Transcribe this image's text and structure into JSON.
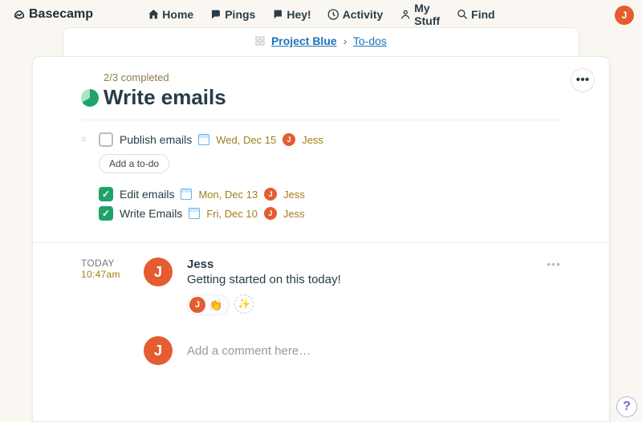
{
  "brand": "Basecamp",
  "nav": {
    "home": "Home",
    "pings": "Pings",
    "hey": "Hey!",
    "activity": "Activity",
    "mystuff": "My Stuff",
    "find": "Find"
  },
  "user_initial": "J",
  "breadcrumb": {
    "project": "Project Blue",
    "separator": "›",
    "section": "To-dos"
  },
  "list": {
    "completed_text": "2/3 completed",
    "title": "Write emails",
    "add_todo_label": "Add a to-do",
    "pending": [
      {
        "title": "Publish emails",
        "date": "Wed, Dec 15",
        "assignee_initial": "J",
        "assignee_name": "Jess"
      }
    ],
    "completed": [
      {
        "title": "Edit emails",
        "date": "Mon, Dec 13",
        "assignee_initial": "J",
        "assignee_name": "Jess"
      },
      {
        "title": "Write Emails",
        "date": "Fri, Dec 10",
        "assignee_initial": "J",
        "assignee_name": "Jess"
      }
    ]
  },
  "comments": [
    {
      "day_label": "TODAY",
      "time": "10:47am",
      "author_initial": "J",
      "author": "Jess",
      "text": "Getting started on this today!",
      "reactions": [
        {
          "avatar_initial": "J",
          "emoji": "👏"
        }
      ]
    }
  ],
  "comment_input": {
    "avatar_initial": "J",
    "placeholder": "Add a comment here…"
  },
  "help_label": "?"
}
